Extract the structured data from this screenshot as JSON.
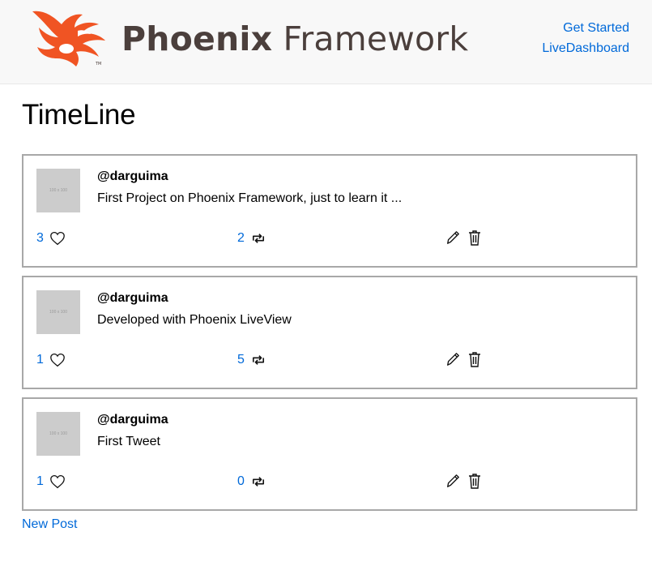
{
  "header": {
    "brand_bold": "Phoenix",
    "brand_light": " Framework",
    "nav": [
      {
        "label": "Get Started"
      },
      {
        "label": "LiveDashboard"
      }
    ]
  },
  "page": {
    "title": "TimeLine"
  },
  "posts": [
    {
      "avatar_text": "100 x 100",
      "username": "@darguima",
      "body": "First Project on Phoenix Framework, just to learn it ...",
      "likes": "3",
      "reposts": "2"
    },
    {
      "avatar_text": "100 x 100",
      "username": "@darguima",
      "body": "Developed with Phoenix LiveView",
      "likes": "1",
      "reposts": "5"
    },
    {
      "avatar_text": "100 x 100",
      "username": "@darguima",
      "body": "First Tweet",
      "likes": "1",
      "reposts": "0"
    }
  ],
  "footer": {
    "new_post": "New Post"
  },
  "icons": {
    "like": "heart-icon",
    "repost": "repost-icon",
    "edit": "pencil-icon",
    "delete": "trash-icon"
  },
  "colors": {
    "link": "#0069d9",
    "logo": "#f05423",
    "brand_text": "#4b3f3c",
    "header_bg": "#f8f8f8",
    "avatar_bg": "#cccccc",
    "card_border": "#a8a8a8"
  }
}
